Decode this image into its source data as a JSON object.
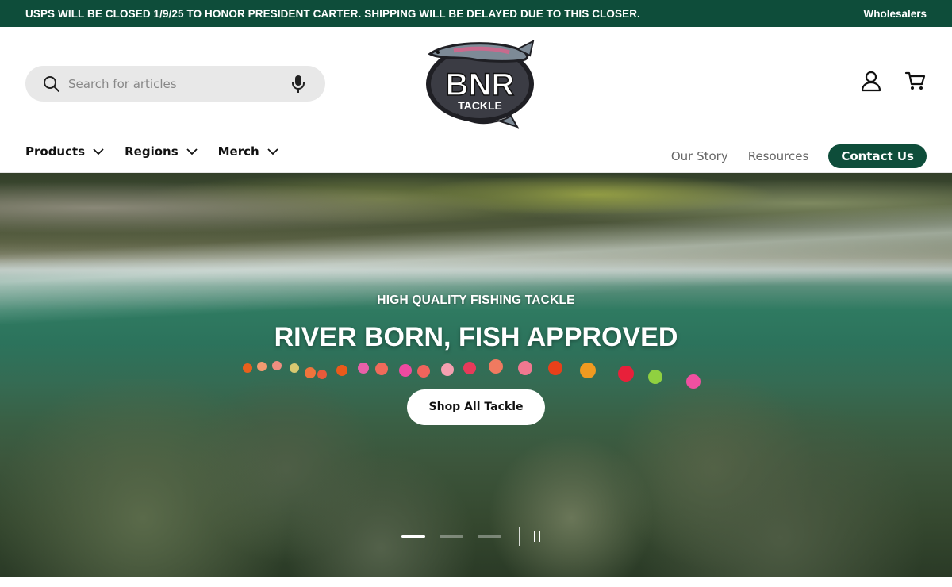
{
  "announcement": {
    "message": "USPS WILL BE CLOSED 1/9/25 TO HONOR PRESIDENT CARTER. SHIPPING WILL BE DELAYED DUE TO THIS CLOSER.",
    "wholesalers": "Wholesalers"
  },
  "search": {
    "placeholder": "Search for articles"
  },
  "logo": {
    "text_main": "BNR",
    "text_sub": "TACKLE"
  },
  "nav": {
    "items": [
      {
        "label": "Products"
      },
      {
        "label": "Regions"
      },
      {
        "label": "Merch"
      }
    ]
  },
  "right_nav": {
    "our_story": "Our Story",
    "resources": "Resources",
    "contact": "Contact Us"
  },
  "hero": {
    "kicker": "HIGH QUALITY FISHING TACKLE",
    "title": "RIVER BORN, FISH APPROVED",
    "cta": "Shop All Tackle",
    "slides_total": 3,
    "slide_active": 1
  },
  "colors": {
    "brand_green": "#0e4d3a"
  },
  "icons": [
    "search-icon",
    "microphone-icon",
    "account-icon",
    "cart-icon",
    "chevron-down-icon",
    "pause-icon"
  ]
}
